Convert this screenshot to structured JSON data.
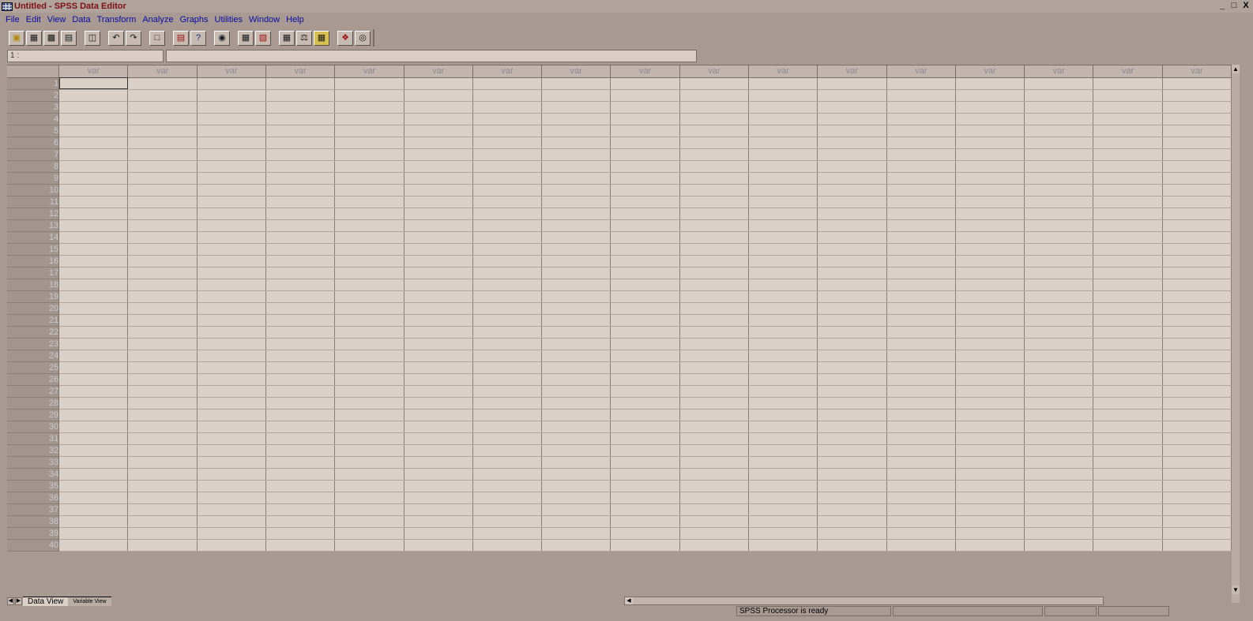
{
  "window": {
    "title": "Untitled - SPSS Data Editor",
    "controls": [
      "_",
      "□",
      "X"
    ]
  },
  "menu": [
    "File",
    "Edit",
    "View",
    "Data",
    "Transform",
    "Analyze",
    "Graphs",
    "Utilities",
    "Window",
    "Help"
  ],
  "toolbar": {
    "icons": [
      "open-folder-icon",
      "save-icon",
      "print-icon",
      "dialog-recall-icon",
      "undo-icon",
      "redo-icon",
      "goto-chart-icon",
      "goto-case-icon",
      "variables-icon",
      "find-icon",
      "insert-case-icon",
      "insert-variable-icon",
      "split-file-icon",
      "weight-cases-icon",
      "select-cases-icon",
      "value-labels-icon",
      "use-sets-icon"
    ]
  },
  "cell_editor": {
    "reference": "1 :",
    "value": ""
  },
  "grid": {
    "column_header": "var",
    "column_count": 17,
    "row_count": 40,
    "active_cell": "1,1"
  },
  "tabs": {
    "data_view": "Data View",
    "variable_view": "Variable View"
  },
  "status": {
    "processor": "SPSS Processor  is ready"
  },
  "colors": {
    "title_text": "#7d0f16",
    "menu_text": "#0a0aa0",
    "background": "#a89a92",
    "cell": "#dbd0c8"
  }
}
